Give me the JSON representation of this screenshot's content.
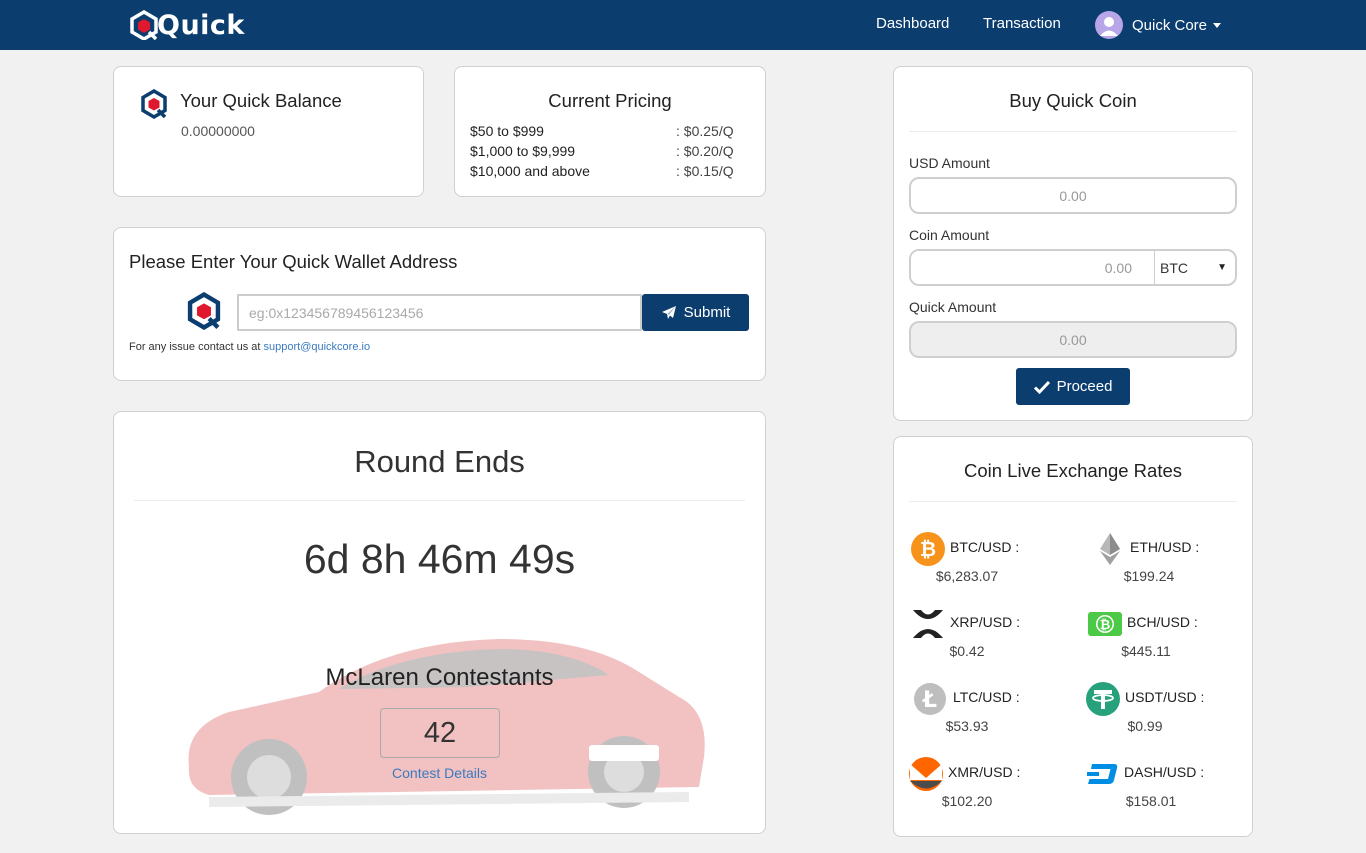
{
  "nav": {
    "brand": "Quick",
    "dashboard": "Dashboard",
    "transaction": "Transaction",
    "user": "Quick Core"
  },
  "balance": {
    "title": "Your Quick Balance",
    "value": "0.00000000"
  },
  "pricing": {
    "title": "Current Pricing",
    "rows": [
      {
        "range": "$50 to $999",
        "rate": ": $0.25/Q"
      },
      {
        "range": "$1,000 to $9,999",
        "rate": ": $0.20/Q"
      },
      {
        "range": "$10,000 and above",
        "rate": ": $0.15/Q"
      }
    ]
  },
  "wallet": {
    "title": "Please Enter Your Quick Wallet Address",
    "placeholder": "eg:0x123456789456123456",
    "submit": "Submit",
    "support_prefix": "For any issue contact us at ",
    "support_email": "support@quickcore.io"
  },
  "round": {
    "title": "Round Ends",
    "countdown": "6d 8h 46m 49s",
    "contest_title": "McLaren Contestants",
    "contestants": "42",
    "details_link": "Contest Details"
  },
  "buy": {
    "title": "Buy Quick Coin",
    "usd_label": "USD Amount",
    "usd_placeholder": "0.00",
    "coin_label": "Coin Amount",
    "coin_placeholder": "0.00",
    "coin_selected": "BTC",
    "quick_label": "Quick Amount",
    "quick_placeholder": "0.00",
    "proceed": "Proceed"
  },
  "rates": {
    "title": "Coin Live Exchange Rates",
    "items": [
      {
        "pair": "BTC/USD :",
        "price": "$6,283.07",
        "icon": "bitcoin-icon",
        "color": "#f7931a"
      },
      {
        "pair": "ETH/USD :",
        "price": "$199.24",
        "icon": "ethereum-icon",
        "color": "#8c8c8c"
      },
      {
        "pair": "XRP/USD :",
        "price": "$0.42",
        "icon": "xrp-icon",
        "color": "#222222"
      },
      {
        "pair": "BCH/USD :",
        "price": "$445.11",
        "icon": "bitcoin-cash-icon",
        "color": "#4cc947"
      },
      {
        "pair": "LTC/USD :",
        "price": "$53.93",
        "icon": "litecoin-icon",
        "color": "#bebebe"
      },
      {
        "pair": "USDT/USD :",
        "price": "$0.99",
        "icon": "tether-icon",
        "color": "#26a17b"
      },
      {
        "pair": "XMR/USD :",
        "price": "$102.20",
        "icon": "monero-icon",
        "color": "#ff6600"
      },
      {
        "pair": "DASH/USD :",
        "price": "$158.01",
        "icon": "dash-icon",
        "color": "#008de4"
      }
    ]
  }
}
